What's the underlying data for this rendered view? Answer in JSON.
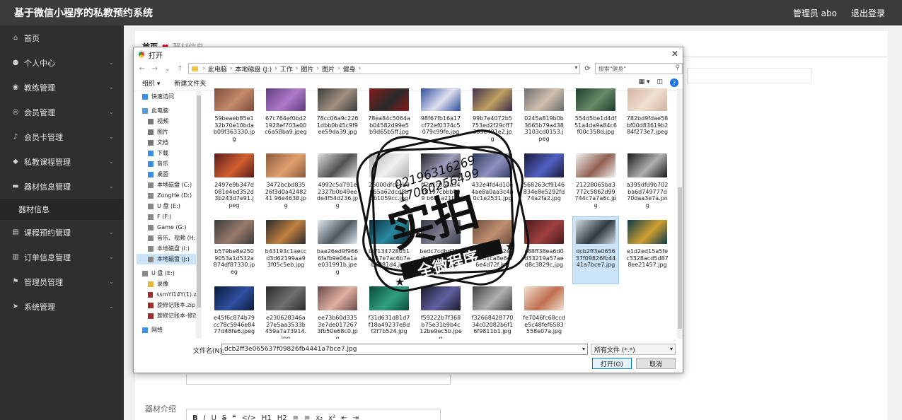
{
  "header": {
    "title": "基于微信小程序的私教预约系统",
    "user": "管理员 abo",
    "logout": "退出登录"
  },
  "sidebar": {
    "items": [
      {
        "label": "首页",
        "icon": "home-icon",
        "glyph": "⌂",
        "chev": false
      },
      {
        "label": "个人中心",
        "icon": "user-icon",
        "glyph": "●",
        "chev": true
      },
      {
        "label": "教练管理",
        "icon": "compass-icon",
        "glyph": "◉",
        "chev": true
      },
      {
        "label": "会员管理",
        "icon": "member-icon",
        "glyph": "◎",
        "chev": true
      },
      {
        "label": "会员卡管理",
        "icon": "mic-icon",
        "glyph": "♪",
        "chev": true
      },
      {
        "label": "私教课程管理",
        "icon": "tag-icon",
        "glyph": "◆",
        "chev": true
      },
      {
        "label": "器材信息管理",
        "icon": "chat-icon",
        "glyph": "▬",
        "chev": true
      }
    ],
    "sub": "器材信息",
    "items2": [
      {
        "label": "课程预约管理",
        "icon": "doc-icon",
        "glyph": "▤",
        "chev": true
      },
      {
        "label": "订单信息管理",
        "icon": "list-icon",
        "glyph": "▥",
        "chev": true
      },
      {
        "label": "管理员管理",
        "icon": "flag-icon",
        "glyph": "⚑",
        "chev": true
      },
      {
        "label": "系统管理",
        "icon": "send-icon",
        "glyph": "➤",
        "chev": true
      }
    ]
  },
  "breadcrumb": {
    "home": "首页",
    "current": "器材信息"
  },
  "form": {
    "intro_label": "器材介绍"
  },
  "editor_toolbar": [
    "B",
    "I",
    "U",
    "S",
    "❝",
    "</>",
    "H1",
    "H2",
    "≡",
    "≡",
    "x₂",
    "x²",
    "⇤",
    "⇥"
  ],
  "dialog": {
    "title": "打开",
    "path": [
      "此电脑",
      "本地磁盘 (J:)",
      "工作",
      "图片",
      "图片",
      "健身"
    ],
    "search_placeholder": "搜索\"健身\"",
    "organize": "组织 ▾",
    "new_folder": "新建文件夹",
    "nav": [
      {
        "label": "快速访问",
        "indent": 0,
        "color": "#3c8ee6"
      },
      {
        "label": "此电脑",
        "indent": 0,
        "color": "#5a9bd5"
      },
      {
        "label": "视频",
        "indent": 1,
        "color": "#777"
      },
      {
        "label": "图片",
        "indent": 1,
        "color": "#777"
      },
      {
        "label": "文档",
        "indent": 1,
        "color": "#777"
      },
      {
        "label": "下载",
        "indent": 1,
        "color": "#3c8ee6"
      },
      {
        "label": "音乐",
        "indent": 1,
        "color": "#3c8ee6"
      },
      {
        "label": "桌面",
        "indent": 1,
        "color": "#3c8ee6"
      },
      {
        "label": "本地磁盘 (C:)",
        "indent": 1,
        "color": "#888"
      },
      {
        "label": "ZongHe (D:)",
        "indent": 1,
        "color": "#888"
      },
      {
        "label": "U 盘 (E:)",
        "indent": 1,
        "color": "#888"
      },
      {
        "label": "F (F:)",
        "indent": 1,
        "color": "#888"
      },
      {
        "label": "Game (G:)",
        "indent": 1,
        "color": "#888"
      },
      {
        "label": "音乐、视频 (H:)",
        "indent": 1,
        "color": "#888"
      },
      {
        "label": "本地磁盘 (I:)",
        "indent": 1,
        "color": "#888"
      },
      {
        "label": "本地磁盘 (J:)",
        "indent": 1,
        "color": "#888",
        "sel": true
      },
      {
        "label": "U 盘 (E:)",
        "indent": 0,
        "color": "#888"
      },
      {
        "label": "录像",
        "indent": 1,
        "color": "#e6b53c"
      },
      {
        "label": "ssmYl14Y(1).zip",
        "indent": 1,
        "color": "#a03030"
      },
      {
        "label": "旋修记账本.zip",
        "indent": 1,
        "color": "#a03030"
      },
      {
        "label": "旋修记账本-修改",
        "indent": 1,
        "color": "#a03030"
      },
      {
        "label": "网络",
        "indent": 0,
        "color": "#3c8ee6"
      }
    ],
    "files": [
      {
        "name": "59beaeb85e132b70e10bdab09f363330.jpg",
        "c1": "#7a4a3a",
        "c2": "#c48a6a"
      },
      {
        "name": "67c764ef0bd21928ef703a00c6a58ba9.jpeg",
        "c1": "#5a3a7a",
        "c2": "#b07acb"
      },
      {
        "name": "78cc06a9c2261dbb0b45c9f9ee59da39.jpg",
        "c1": "#3a3a3a",
        "c2": "#a09080"
      },
      {
        "name": "78ea84c5064ab04582d99e5b9d65b5ff.jpg",
        "c1": "#8a1a1a",
        "c2": "#2a2a2a"
      },
      {
        "name": "98f67fb16a17cf72ef0374c5079c99fe.jpg",
        "c1": "#2a4a9a",
        "c2": "#e0e0f0"
      },
      {
        "name": "99b7e4072b5753ed2f29cff7363e491e2.jpg",
        "c1": "#3a2a4a",
        "c2": "#c0a060"
      },
      {
        "name": "0245a819b0b3665b79a4383103cd0153.jpeg",
        "c1": "#6a6a6a",
        "c2": "#d0c0b0"
      },
      {
        "name": "554d5be1d4df51a4da9a84c6f00c358d.jpg",
        "c1": "#1a3a2a",
        "c2": "#6a8a6a"
      },
      {
        "name": "782bd9fdae58bf00d83619b284f273e7.jpeg",
        "c1": "#d0b0a0",
        "c2": "#f0e0d0"
      },
      {
        "name": "2497e9b347d081e4ed352d3b243d7e91.jpeg",
        "c1": "#5a1a1a",
        "c2": "#d06030"
      },
      {
        "name": "3472bcbd83526f3d0a4248241 96e4638.jpg",
        "c1": "#8a5a3a",
        "c2": "#e0a070"
      },
      {
        "name": "4992c5d791e2327b0b49eede4f54d236.jpg",
        "c1": "#e0e0e0",
        "c2": "#505050"
      },
      {
        "name": "26000dfc4eb0665a62dcd8bbb1059cc.jpg",
        "c1": "#b0b0b0",
        "c2": "#f0f0f0"
      },
      {
        "name": "ff2a1c9a4a3428197cbbb8e9 b6a1a21fa.jpg",
        "c1": "#202020",
        "c2": "#a0a0c0"
      },
      {
        "name": "432e4fd4d10e4ae8a0aa3c4b0c1e2531.jpg",
        "c1": "#2a3a5a",
        "c2": "#9090c0"
      },
      {
        "name": "568263cf9146834e8e5292fd74a2fa2.jpg",
        "c1": "#1a1a3a",
        "c2": "#5060c0"
      },
      {
        "name": "21228065ba3772c5862d99744c7a7a6c.jpg",
        "c1": "#f0f0f0",
        "c2": "#906050"
      },
      {
        "name": "a395dfd9b702ba6d749777d70daa3e7a.png",
        "c1": "#1a1a1a",
        "c2": "#b0b0b0"
      },
      {
        "name": "b579be8e2509053a1d532a874df87330.jpeg",
        "c1": "#3a3a3a",
        "c2": "#9a7a6a"
      },
      {
        "name": "b43193c1aeccd3d62199aa93f05c5eb.jpg",
        "c1": "#2a2a2a",
        "c2": "#c08040"
      },
      {
        "name": "bae26ed9f9666fafb9e06a1ae031991b.jpeg",
        "c1": "#e0e8f0",
        "c2": "#505860"
      },
      {
        "name": "bcf134728051b457e7ac6b7eb6781d4.jpg",
        "c1": "#0a2a3a",
        "c2": "#2a8aa0"
      },
      {
        "name": "bedc7cdbd72bdb3d0ef50cc0a2e3e6.jpg",
        "c1": "#3a3a4a",
        "c2": "#808090"
      },
      {
        "name": "c0b76a2ab2e77c2d1ca8e6ef6e4d72f.jpg",
        "c1": "#6a4a3a",
        "c2": "#c09070"
      },
      {
        "name": "c88ff38ea6d0d33219a57aed8c3829c.jpg",
        "c1": "#4a1a1a",
        "c2": "#a04040"
      },
      {
        "name": "dcb2ff3e065637f09826fb4441a7bce7.jpg",
        "c1": "#d0d8e0",
        "c2": "#303840",
        "sel": true
      },
      {
        "name": "e1d2ed15a5fec3328acd5d878ee21457.jpg",
        "c1": "#0a3a4a",
        "c2": "#d0a030"
      },
      {
        "name": "e45f6c874b79cc78c5946e8477d48fe6.jpeg",
        "c1": "#0a1a3a",
        "c2": "#3050a0"
      },
      {
        "name": "e230628346a27e5aa3533b459a7a73914.jpg",
        "c1": "#2a2a2a",
        "c2": "#707070"
      },
      {
        "name": "ee73b60d3353e7de0172673fb50e68c0.jpg",
        "c1": "#6a4a4a",
        "c2": "#e0b0a0"
      },
      {
        "name": "f31d631d81d7f18a49237e8df2f7b524.jpg",
        "c1": "#0a4a3a",
        "c2": "#30a080"
      },
      {
        "name": "f59222b7f368b75e31b9b4c12be9ec5b.jpeg",
        "c1": "#1a1a2a",
        "c2": "#6060a0"
      },
      {
        "name": "f3266842877034c02082b6f16f9811b1.jpg",
        "c1": "#404040",
        "c2": "#b0b0b0"
      },
      {
        "name": "fe7046fc68ccde5c48fef6583558e07a.jpg",
        "c1": "#f0e0d0",
        "c2": "#c07050"
      }
    ],
    "filename_label": "文件名(N):",
    "filename_value": "dcb2ff3e065637f09826fb4441a7bce7.jpg",
    "filetype": "所有文件 (*.*)",
    "open": "打开(O)",
    "cancel": "取消"
  },
  "watermark": {
    "main": "实拍",
    "sub": "全微程序",
    "phone1": "02196316269",
    "phone2": "17060256499"
  },
  "colors": {
    "header_bg": "#3b3b3b",
    "sidebar_bg": "#2f2f2f",
    "selection": "#cce4f7",
    "heart": "#d0021b"
  }
}
